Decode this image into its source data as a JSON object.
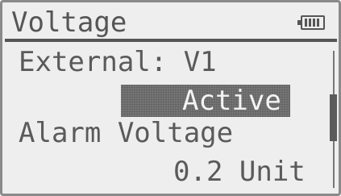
{
  "header": {
    "title": "Voltage",
    "battery_icon": "battery-icon"
  },
  "settings": {
    "external_label": "External: V1",
    "external_status": "Active",
    "alarm_label": "Alarm Voltage",
    "alarm_value": "0.2 Unit"
  },
  "scrollbar": {
    "position_fraction": 0.45
  },
  "colors": {
    "background": "#eeeeee",
    "text": "#5a5a5a",
    "highlight": "#6e6e6e",
    "highlight_text": "#f4f4f4"
  }
}
